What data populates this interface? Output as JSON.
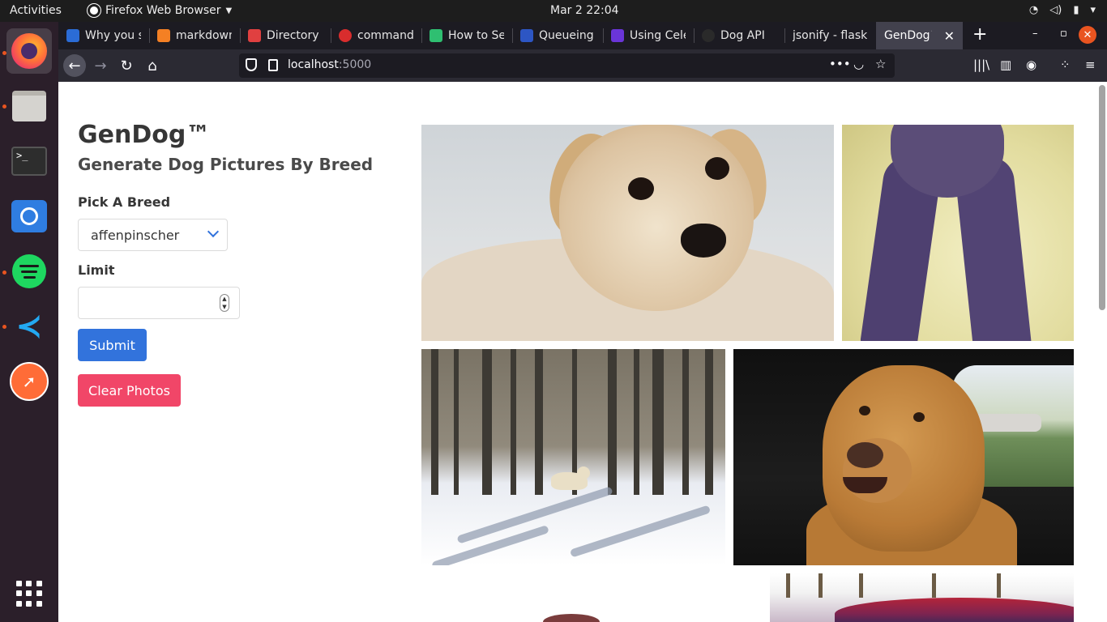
{
  "system_bar": {
    "activities_label": "Activities",
    "app_menu_label": "Firefox Web Browser",
    "clock": "Mar 2  22:04",
    "tray_icons": [
      "wifi-icon",
      "volume-icon",
      "battery-icon",
      "power-menu-icon"
    ]
  },
  "dock": {
    "apps": [
      {
        "name": "Firefox",
        "icon": "firefox-icon",
        "running": true,
        "active": true
      },
      {
        "name": "Files",
        "icon": "files-icon",
        "running": true
      },
      {
        "name": "Terminal",
        "icon": "terminal-icon",
        "running": false
      },
      {
        "name": "Ubuntu Software",
        "icon": "software-store-icon",
        "running": false
      },
      {
        "name": "Spotify",
        "icon": "spotify-icon",
        "running": true
      },
      {
        "name": "Visual Studio Code",
        "icon": "vscode-icon",
        "running": true
      },
      {
        "name": "Postman",
        "icon": "postman-icon",
        "running": false
      }
    ],
    "terminal_glyph": ">_",
    "show_apps_icon": "app-grid-icon"
  },
  "tabs": [
    {
      "title": "Why you sl",
      "favicon_color": "#2b6cd6"
    },
    {
      "title": "markdown",
      "favicon_color": "#f48024"
    },
    {
      "title": "Directory S",
      "favicon_color": "#e04040"
    },
    {
      "title": "command",
      "favicon_color": "#d92d2d"
    },
    {
      "title": "How to Se",
      "favicon_color": "#2fbf71"
    },
    {
      "title": "Queueing",
      "favicon_color": "#2d56c4"
    },
    {
      "title": "Using Cele",
      "favicon_color": "#6a35d8"
    },
    {
      "title": "Dog API",
      "favicon_color": "#2a2a2a"
    },
    {
      "title": "jsonify - flask",
      "favicon_color": "#1c1b22"
    },
    {
      "title": "GenDog™",
      "favicon_color": "#42414d",
      "active": true
    }
  ],
  "tab_controls": {
    "new_tab": "+",
    "close_tab": "✕",
    "minimize": "–",
    "maximize": "▫",
    "close_window": "✕"
  },
  "navbar": {
    "url_host": "localhost",
    "url_port": ":5000",
    "back_icon": "←",
    "forward_icon": "→",
    "reload_icon": "↻",
    "home_icon": "⌂",
    "page_actions_icon": "•••",
    "pocket_icon": "◡",
    "bookmark_icon": "☆",
    "library_icon": "|||\\",
    "sidebar_icon": "▥",
    "account_icon": "◉",
    "extensions_icon": "⁘",
    "menu_icon": "≡"
  },
  "page": {
    "title": "GenDog™",
    "subtitle": "Generate Dog Pictures By Breed",
    "breed_label": "Pick A Breed",
    "breed_selected": "affenpinscher",
    "limit_label": "Limit",
    "limit_value": "",
    "submit_label": "Submit",
    "clear_label": "Clear Photos",
    "colors": {
      "submit": "#3273dc",
      "clear": "#f14668"
    }
  },
  "photos": [
    {
      "subject": "yellow lab puppy lying down"
    },
    {
      "subject": "chocolate lab legs on rug"
    },
    {
      "subject": "dog in snowy forest"
    },
    {
      "subject": "red lab in car seat"
    },
    {
      "subject": "partial photo"
    },
    {
      "subject": "partial photo of car"
    }
  ]
}
